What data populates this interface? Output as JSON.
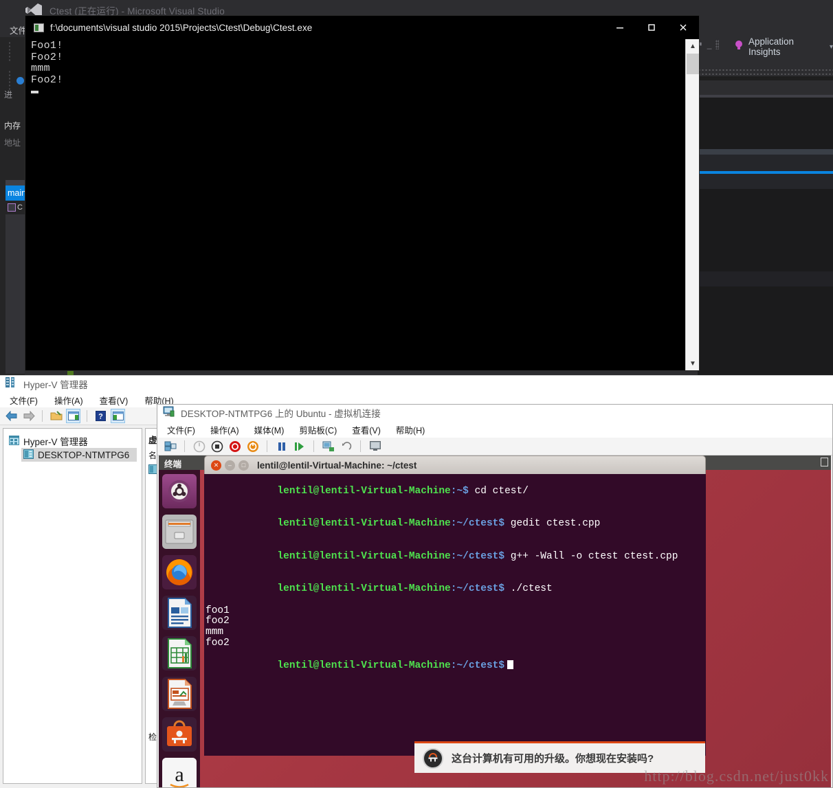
{
  "visual_studio": {
    "title": "Ctest (正在运行) - Microsoft Visual Studio",
    "menu_file": "文件",
    "rail": {
      "process_label": "进",
      "memory_label": "内存",
      "address_label": "地址"
    },
    "tab_main": "main",
    "app_insights": "Application Insights",
    "accent_color": "#0a84e0"
  },
  "console": {
    "path_title": "f:\\documents\\visual studio 2015\\Projects\\Ctest\\Debug\\Ctest.exe",
    "minimize": "–",
    "maximize": "□",
    "close": "✕",
    "lines": [
      "Foo1!",
      "Foo2!",
      "mmm",
      "Foo2!"
    ],
    "scroll_up": "▲",
    "scroll_down": "▼"
  },
  "hyperv": {
    "title": "Hyper-V 管理器",
    "menu": [
      "文件(F)",
      "操作(A)",
      "查看(V)",
      "帮助(H)"
    ],
    "tree_root": "Hyper-V 管理器",
    "tree_child": "DESKTOP-NTMTPG6",
    "vm_header": "虚",
    "column_header": "名",
    "bottom_label": "检"
  },
  "vm_connection": {
    "title": "DESKTOP-NTMTPG6 上的 Ubuntu - 虚拟机连接",
    "menu": [
      "文件(F)",
      "操作(A)",
      "媒体(M)",
      "剪贴板(C)",
      "查看(V)",
      "帮助(H)"
    ]
  },
  "ubuntu": {
    "top_panel_title": "终端",
    "launcher_icons": [
      "ubuntu-dash-icon",
      "files-icon",
      "firefox-icon",
      "libreoffice-writer-icon",
      "libreoffice-calc-icon",
      "libreoffice-impress-icon",
      "ubuntu-software-icon",
      "amazon-icon"
    ],
    "wallpaper_color": "#a63742",
    "notification_text": "这台计算机有可用的升级。你想现在安装吗?"
  },
  "terminal": {
    "title": "lentil@lentil-Virtual-Machine: ~/ctest",
    "close_glyph": "✕",
    "minimize_glyph": "–",
    "maximize_glyph": "□",
    "lines": [
      {
        "user": "lentil@lentil-Virtual-Machine",
        "path": ":~$",
        "cmd": " cd ctest/"
      },
      {
        "user": "lentil@lentil-Virtual-Machine",
        "path": ":~/ctest$",
        "cmd": " gedit ctest.cpp"
      },
      {
        "user": "lentil@lentil-Virtual-Machine",
        "path": ":~/ctest$",
        "cmd": " g++ -Wall -o ctest ctest.cpp"
      },
      {
        "user": "lentil@lentil-Virtual-Machine",
        "path": ":~/ctest$",
        "cmd": " ./ctest"
      },
      {
        "user": "",
        "path": "",
        "cmd": "foo1"
      },
      {
        "user": "",
        "path": "",
        "cmd": "foo2"
      },
      {
        "user": "",
        "path": "",
        "cmd": "mmm"
      },
      {
        "user": "",
        "path": "",
        "cmd": "foo2"
      },
      {
        "user": "lentil@lentil-Virtual-Machine",
        "path": ":~/ctest$",
        "cmd": ""
      }
    ]
  },
  "watermark": "http://blog.csdn.net/just0kk"
}
